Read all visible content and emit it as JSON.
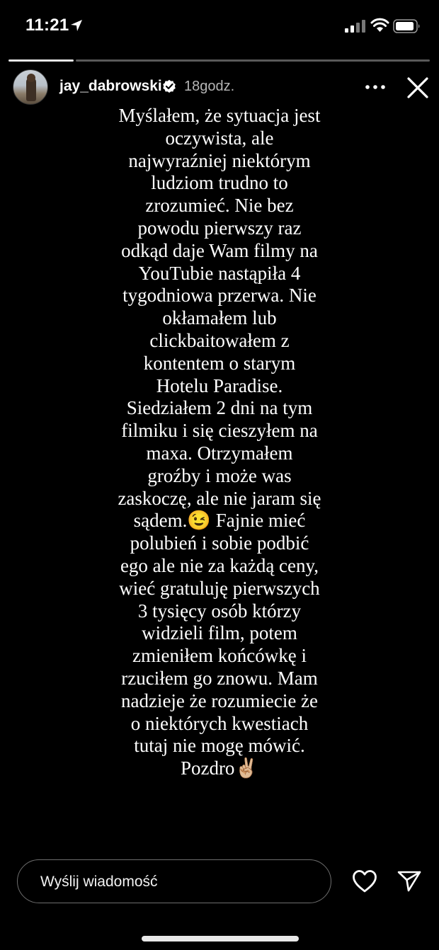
{
  "status_bar": {
    "time": "11:21",
    "icons": [
      "location-icon",
      "signal-icon",
      "wifi-icon",
      "battery-icon"
    ]
  },
  "story": {
    "progress": {
      "segments": 2,
      "current_segment": 2
    },
    "header": {
      "username": "jay_dabrowski",
      "verified": true,
      "posted": "18godz.",
      "icons": [
        "avatar",
        "verified-icon",
        "more-icon",
        "close-icon"
      ]
    },
    "text_lines": [
      "Myślałem, że sytuacja jest",
      "oczywista, ale",
      "najwyraźniej niektórym",
      "ludziom trudno to",
      "zrozumieć. Nie bez",
      "powodu pierwszy raz",
      "odkąd daje Wam filmy na",
      "YouTubie nastąpiła 4",
      "tygodniowa przerwa. Nie",
      "okłamałem lub",
      "clickbaitowałem z",
      "kontentem o starym",
      "Hotelu Paradise.",
      "Siedziałem 2 dni na tym",
      "filmiku i się cieszyłem na",
      "maxa. Otrzymałem",
      "groźby i może was",
      "zaskoczę, ale nie jaram się",
      "sądem.😉 Fajnie mieć",
      "polubień i sobie podbić",
      "ego ale nie za każdą ceny,",
      "wieć gratuluję pierwszych",
      "3 tysięcy osób którzy",
      "widzieli film, potem",
      "zmieniłem końcówkę i",
      "rzuciłem go znowu. Mam",
      "nadzieje że rozumiecie że",
      "o niektórych kwestiach",
      "tutaj nie mogę mówić.",
      "Pozdro✌🏼"
    ]
  },
  "footer": {
    "message_placeholder": "Wyślij wiadomość",
    "icons": [
      "like-icon",
      "send-icon"
    ]
  },
  "colors": {
    "background": "#000000",
    "text": "#ffffff",
    "secondary_text": "#b5b5b5",
    "verified": "#ffffff",
    "input_border": "#6e6e6e"
  }
}
